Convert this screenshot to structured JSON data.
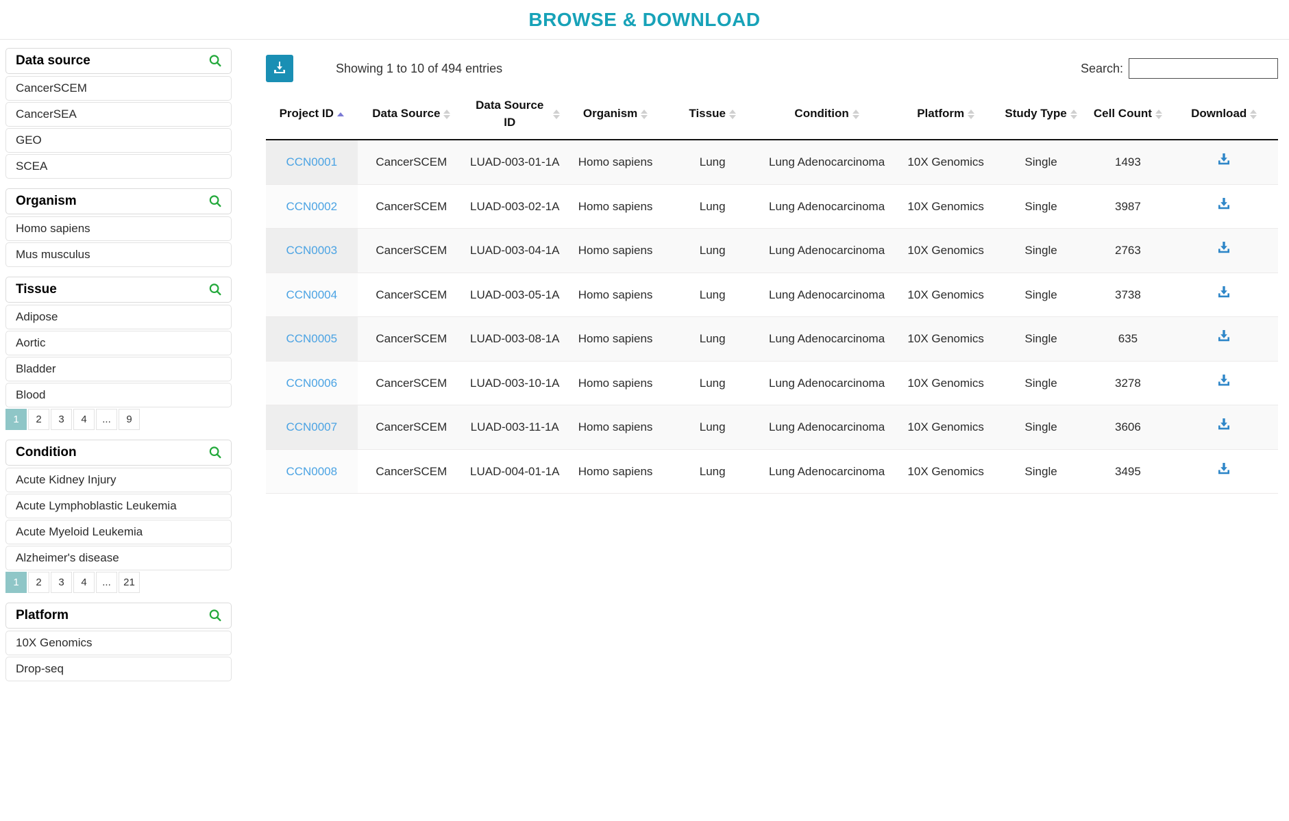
{
  "header": {
    "title": "BROWSE & DOWNLOAD",
    "accent_color": "#17a2b8"
  },
  "sidebar": {
    "facets": [
      {
        "title": "Data source",
        "search_icon": "search-icon",
        "items": [
          "CancerSCEM",
          "CancerSEA",
          "GEO",
          "SCEA"
        ],
        "pagination": null
      },
      {
        "title": "Organism",
        "search_icon": "search-icon",
        "items": [
          "Homo sapiens",
          "Mus musculus"
        ],
        "pagination": null
      },
      {
        "title": "Tissue",
        "search_icon": "search-icon",
        "items": [
          "Adipose",
          "Aortic",
          "Bladder",
          "Blood"
        ],
        "pagination": {
          "pages": [
            "1",
            "2",
            "3",
            "4",
            "...",
            "9"
          ],
          "active": "1"
        }
      },
      {
        "title": "Condition",
        "search_icon": "search-icon",
        "items": [
          "Acute Kidney Injury",
          "Acute Lymphoblastic Leukemia",
          "Acute Myeloid Leukemia",
          "Alzheimer's disease"
        ],
        "pagination": {
          "pages": [
            "1",
            "2",
            "3",
            "4",
            "...",
            "21"
          ],
          "active": "1"
        }
      },
      {
        "title": "Platform",
        "search_icon": "search-icon",
        "items": [
          "10X Genomics",
          "Drop-seq"
        ],
        "pagination": null
      }
    ]
  },
  "toolbar": {
    "download_all_icon": "download-icon",
    "showing_entries": "Showing 1 to 10 of 494 entries",
    "search_label": "Search:",
    "search_value": "",
    "search_placeholder": ""
  },
  "table": {
    "columns": [
      {
        "label": "Project ID",
        "sort": "asc"
      },
      {
        "label": "Data Source",
        "sort": "none"
      },
      {
        "label": "Data Source ID",
        "sort": "none"
      },
      {
        "label": "Organism",
        "sort": "none"
      },
      {
        "label": "Tissue",
        "sort": "none"
      },
      {
        "label": "Condition",
        "sort": "none"
      },
      {
        "label": "Platform",
        "sort": "none"
      },
      {
        "label": "Study Type",
        "sort": "none"
      },
      {
        "label": "Cell Count",
        "sort": "none"
      },
      {
        "label": "Download",
        "sort": "none"
      }
    ],
    "rows": [
      {
        "project_id": "CCN0001",
        "data_source": "CancerSCEM",
        "data_source_id": "LUAD-003-01-1A",
        "organism": "Homo sapiens",
        "tissue": "Lung",
        "condition": "Lung Adenocarcinoma",
        "platform": "10X Genomics",
        "study_type": "Single",
        "cell_count": "1493",
        "download_icon": "download-icon"
      },
      {
        "project_id": "CCN0002",
        "data_source": "CancerSCEM",
        "data_source_id": "LUAD-003-02-1A",
        "organism": "Homo sapiens",
        "tissue": "Lung",
        "condition": "Lung Adenocarcinoma",
        "platform": "10X Genomics",
        "study_type": "Single",
        "cell_count": "3987",
        "download_icon": "download-icon"
      },
      {
        "project_id": "CCN0003",
        "data_source": "CancerSCEM",
        "data_source_id": "LUAD-003-04-1A",
        "organism": "Homo sapiens",
        "tissue": "Lung",
        "condition": "Lung Adenocarcinoma",
        "platform": "10X Genomics",
        "study_type": "Single",
        "cell_count": "2763",
        "download_icon": "download-icon"
      },
      {
        "project_id": "CCN0004",
        "data_source": "CancerSCEM",
        "data_source_id": "LUAD-003-05-1A",
        "organism": "Homo sapiens",
        "tissue": "Lung",
        "condition": "Lung Adenocarcinoma",
        "platform": "10X Genomics",
        "study_type": "Single",
        "cell_count": "3738",
        "download_icon": "download-icon"
      },
      {
        "project_id": "CCN0005",
        "data_source": "CancerSCEM",
        "data_source_id": "LUAD-003-08-1A",
        "organism": "Homo sapiens",
        "tissue": "Lung",
        "condition": "Lung Adenocarcinoma",
        "platform": "10X Genomics",
        "study_type": "Single",
        "cell_count": "635",
        "download_icon": "download-icon"
      },
      {
        "project_id": "CCN0006",
        "data_source": "CancerSCEM",
        "data_source_id": "LUAD-003-10-1A",
        "organism": "Homo sapiens",
        "tissue": "Lung",
        "condition": "Lung Adenocarcinoma",
        "platform": "10X Genomics",
        "study_type": "Single",
        "cell_count": "3278",
        "download_icon": "download-icon"
      },
      {
        "project_id": "CCN0007",
        "data_source": "CancerSCEM",
        "data_source_id": "LUAD-003-11-1A",
        "organism": "Homo sapiens",
        "tissue": "Lung",
        "condition": "Lung Adenocarcinoma",
        "platform": "10X Genomics",
        "study_type": "Single",
        "cell_count": "3606",
        "download_icon": "download-icon"
      },
      {
        "project_id": "CCN0008",
        "data_source": "CancerSCEM",
        "data_source_id": "LUAD-004-01-1A",
        "organism": "Homo sapiens",
        "tissue": "Lung",
        "condition": "Lung Adenocarcinoma",
        "platform": "10X Genomics",
        "study_type": "Single",
        "cell_count": "3495",
        "download_icon": "download-icon"
      }
    ]
  },
  "colors": {
    "title": "#17a2b8",
    "facet_icon_green": "#22a83a",
    "pager_active": "#8fc6c7",
    "link_blue": "#4ba3e3",
    "row_icon_blue": "#2e86c8",
    "dl_button_teal": "#1a8fb4",
    "sort_active": "#7b7ad4"
  }
}
